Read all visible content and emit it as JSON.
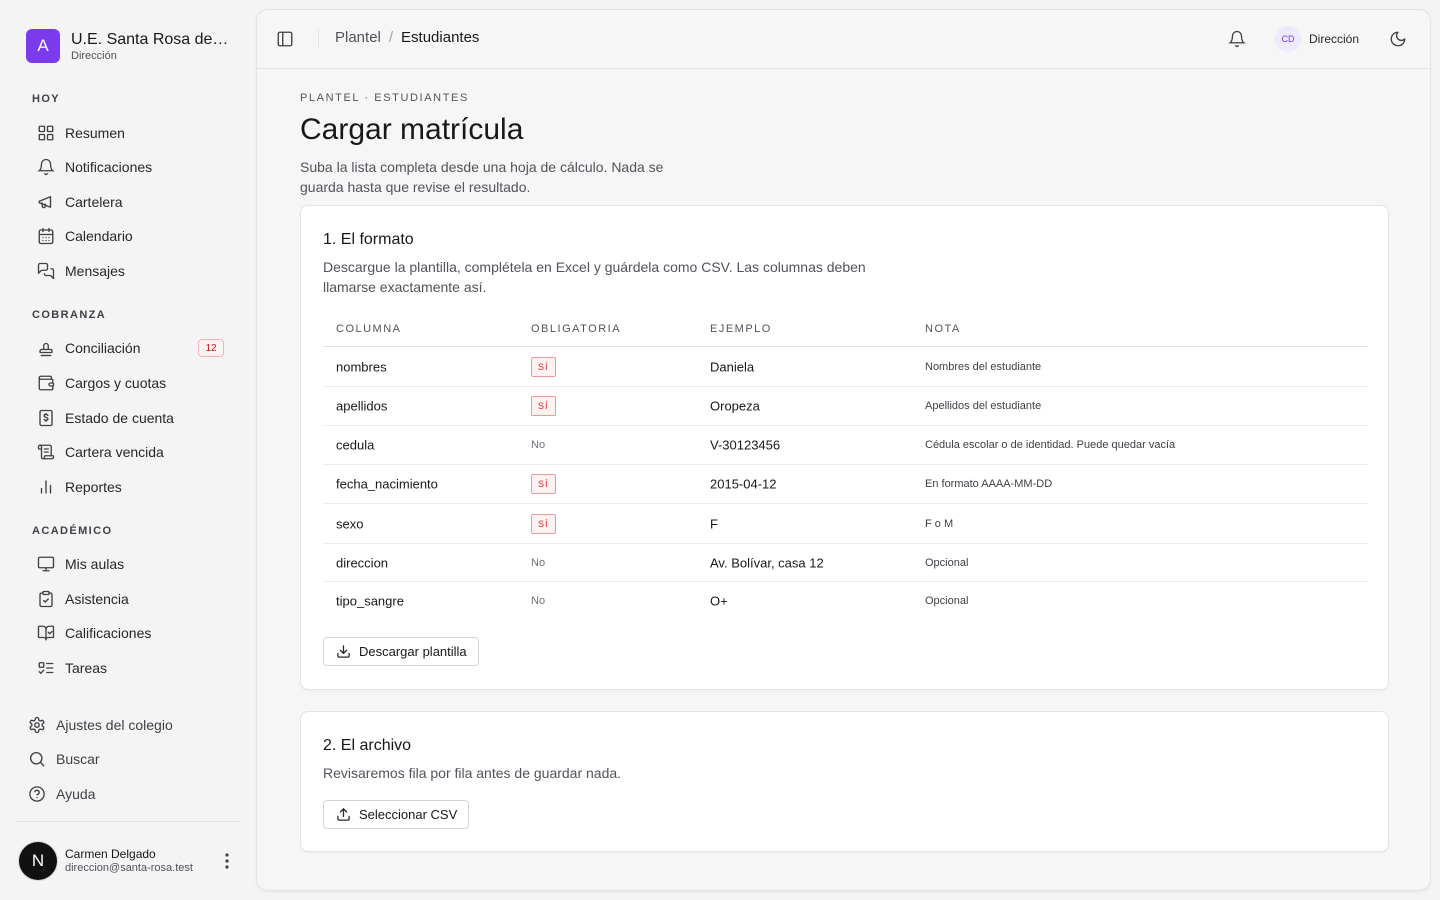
{
  "brand": {
    "logo_letter": "A",
    "name": "U.E. Santa Rosa de Lima",
    "role": "Dirección",
    "accent": "#7c3aed"
  },
  "sidebar": {
    "sections": [
      {
        "label": "HOY",
        "items": [
          {
            "label": "Resumen",
            "icon": "grid-icon"
          },
          {
            "label": "Notificaciones",
            "icon": "bell-icon"
          },
          {
            "label": "Cartelera",
            "icon": "megaphone-icon"
          },
          {
            "label": "Calendario",
            "icon": "calendar-icon"
          },
          {
            "label": "Mensajes",
            "icon": "messages-icon"
          }
        ]
      },
      {
        "label": "COBRANZA",
        "items": [
          {
            "label": "Conciliación",
            "icon": "stamp-icon",
            "badge": "12"
          },
          {
            "label": "Cargos y cuotas",
            "icon": "wallet-icon"
          },
          {
            "label": "Estado de cuenta",
            "icon": "dollar-receipt-icon"
          },
          {
            "label": "Cartera vencida",
            "icon": "receipt-icon"
          },
          {
            "label": "Reportes",
            "icon": "bar-chart-icon"
          }
        ]
      },
      {
        "label": "ACADÉMICO",
        "items": [
          {
            "label": "Mis aulas",
            "icon": "presentation-icon"
          },
          {
            "label": "Asistencia",
            "icon": "clipboard-check-icon"
          },
          {
            "label": "Calificaciones",
            "icon": "book-check-icon"
          },
          {
            "label": "Tareas",
            "icon": "list-todo-icon"
          }
        ]
      }
    ],
    "footer": [
      {
        "label": "Ajustes del colegio",
        "icon": "gear-icon"
      },
      {
        "label": "Buscar",
        "icon": "search-icon"
      },
      {
        "label": "Ayuda",
        "icon": "help-icon"
      }
    ],
    "user": {
      "initial": "N",
      "name": "Carmen Delgado",
      "email": "direccion@santa-rosa.test"
    }
  },
  "topbar": {
    "breadcrumb": [
      "Plantel",
      "Estudiantes"
    ],
    "profile_initials": "CD",
    "profile_name": "Dirección"
  },
  "page": {
    "eyebrow": "PLANTEL · ESTUDIANTES",
    "title": "Cargar matrícula",
    "description": "Suba la lista completa desde una hoja de cálculo. Nada se guarda hasta que revise el resultado."
  },
  "format_card": {
    "title": "1. El formato",
    "description": "Descargue la plantilla, complétela en Excel y guárdela como CSV. Las columnas deben llamarse exactamente así.",
    "columns": [
      "COLUMNA",
      "OBLIGATORIA",
      "EJEMPLO",
      "NOTA"
    ],
    "rows": [
      {
        "column": "nombres",
        "required": "SÍ",
        "example": "Daniela",
        "note": "Nombres del estudiante"
      },
      {
        "column": "apellidos",
        "required": "SÍ",
        "example": "Oropeza",
        "note": "Apellidos del estudiante"
      },
      {
        "column": "cedula",
        "required": "No",
        "example": "V-30123456",
        "note": "Cédula escolar o de identidad. Puede quedar vacía"
      },
      {
        "column": "fecha_nacimiento",
        "required": "SÍ",
        "example": "2015-04-12",
        "note": "En formato AAAA-MM-DD"
      },
      {
        "column": "sexo",
        "required": "SÍ",
        "example": "F",
        "note": "F o M"
      },
      {
        "column": "direccion",
        "required": "No",
        "example": "Av. Bolívar, casa 12",
        "note": "Opcional"
      },
      {
        "column": "tipo_sangre",
        "required": "No",
        "example": "O+",
        "note": "Opcional"
      }
    ],
    "button_label": "Descargar plantilla"
  },
  "file_card": {
    "title": "2. El archivo",
    "description": "Revisaremos fila por fila antes de guardar nada.",
    "button_label": "Seleccionar CSV"
  }
}
